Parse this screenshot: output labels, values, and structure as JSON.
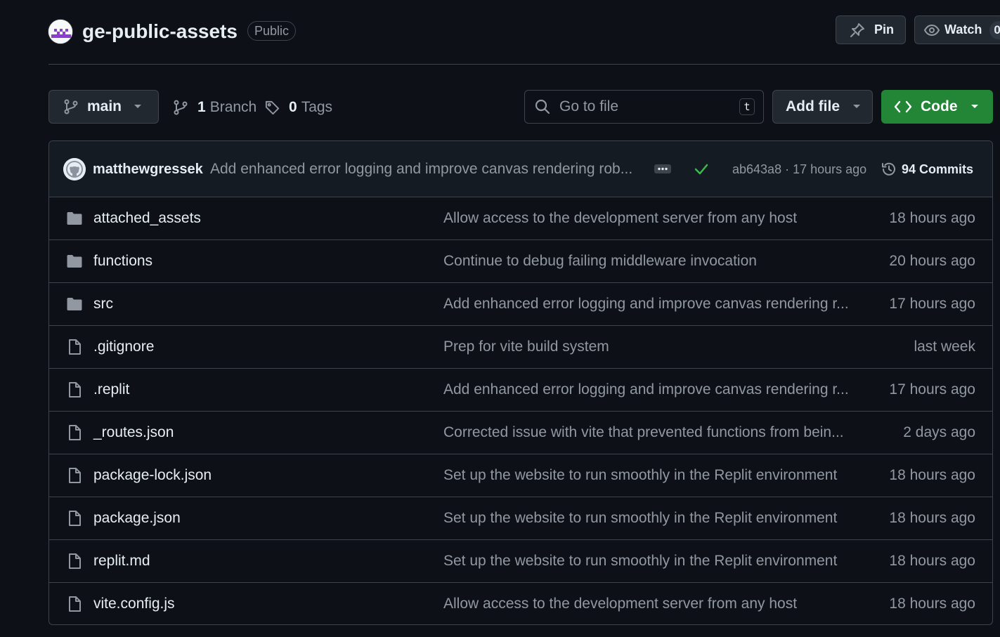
{
  "repo": {
    "name": "ge-public-assets",
    "visibility": "Public",
    "pin_label": "Pin",
    "watch_label": "Watch",
    "watch_count_partial": "0"
  },
  "toolbar": {
    "branch": "main",
    "branch_count": "1",
    "branch_word": "Branch",
    "tag_count": "0",
    "tag_word": "Tags",
    "search_placeholder": "Go to file",
    "search_shortcut": "t",
    "add_file_label": "Add file",
    "code_label": "Code"
  },
  "latest_commit": {
    "author": "matthewgressek",
    "message": "Add enhanced error logging and improve canvas rendering rob...",
    "sha_time": "ab643a8 · 17 hours ago",
    "commits_label": "94 Commits",
    "status": "success"
  },
  "files": [
    {
      "type": "folder",
      "name": "attached_assets",
      "message": "Allow access to the development server from any host",
      "age": "18 hours ago"
    },
    {
      "type": "folder",
      "name": "functions",
      "message": "Continue to debug failing middleware invocation",
      "age": "20 hours ago"
    },
    {
      "type": "folder",
      "name": "src",
      "message": "Add enhanced error logging and improve canvas rendering r...",
      "age": "17 hours ago"
    },
    {
      "type": "file",
      "name": ".gitignore",
      "message": "Prep for vite build system",
      "age": "last week"
    },
    {
      "type": "file",
      "name": ".replit",
      "message": "Add enhanced error logging and improve canvas rendering r...",
      "age": "17 hours ago"
    },
    {
      "type": "file",
      "name": "_routes.json",
      "message": "Corrected issue with vite that prevented functions from bein...",
      "age": "2 days ago"
    },
    {
      "type": "file",
      "name": "package-lock.json",
      "message": "Set up the website to run smoothly in the Replit environment",
      "age": "18 hours ago"
    },
    {
      "type": "file",
      "name": "package.json",
      "message": "Set up the website to run smoothly in the Replit environment",
      "age": "18 hours ago"
    },
    {
      "type": "file",
      "name": "replit.md",
      "message": "Set up the website to run smoothly in the Replit environment",
      "age": "18 hours ago"
    },
    {
      "type": "file",
      "name": "vite.config.js",
      "message": "Allow access to the development server from any host",
      "age": "18 hours ago"
    }
  ],
  "colors": {
    "background": "#0d1117",
    "accent_green": "#238636",
    "check_green": "#3fb950",
    "muted_text": "#9198a1",
    "border": "#3d444d"
  },
  "icons": {
    "folder": "folder-icon",
    "file": "file-icon"
  }
}
